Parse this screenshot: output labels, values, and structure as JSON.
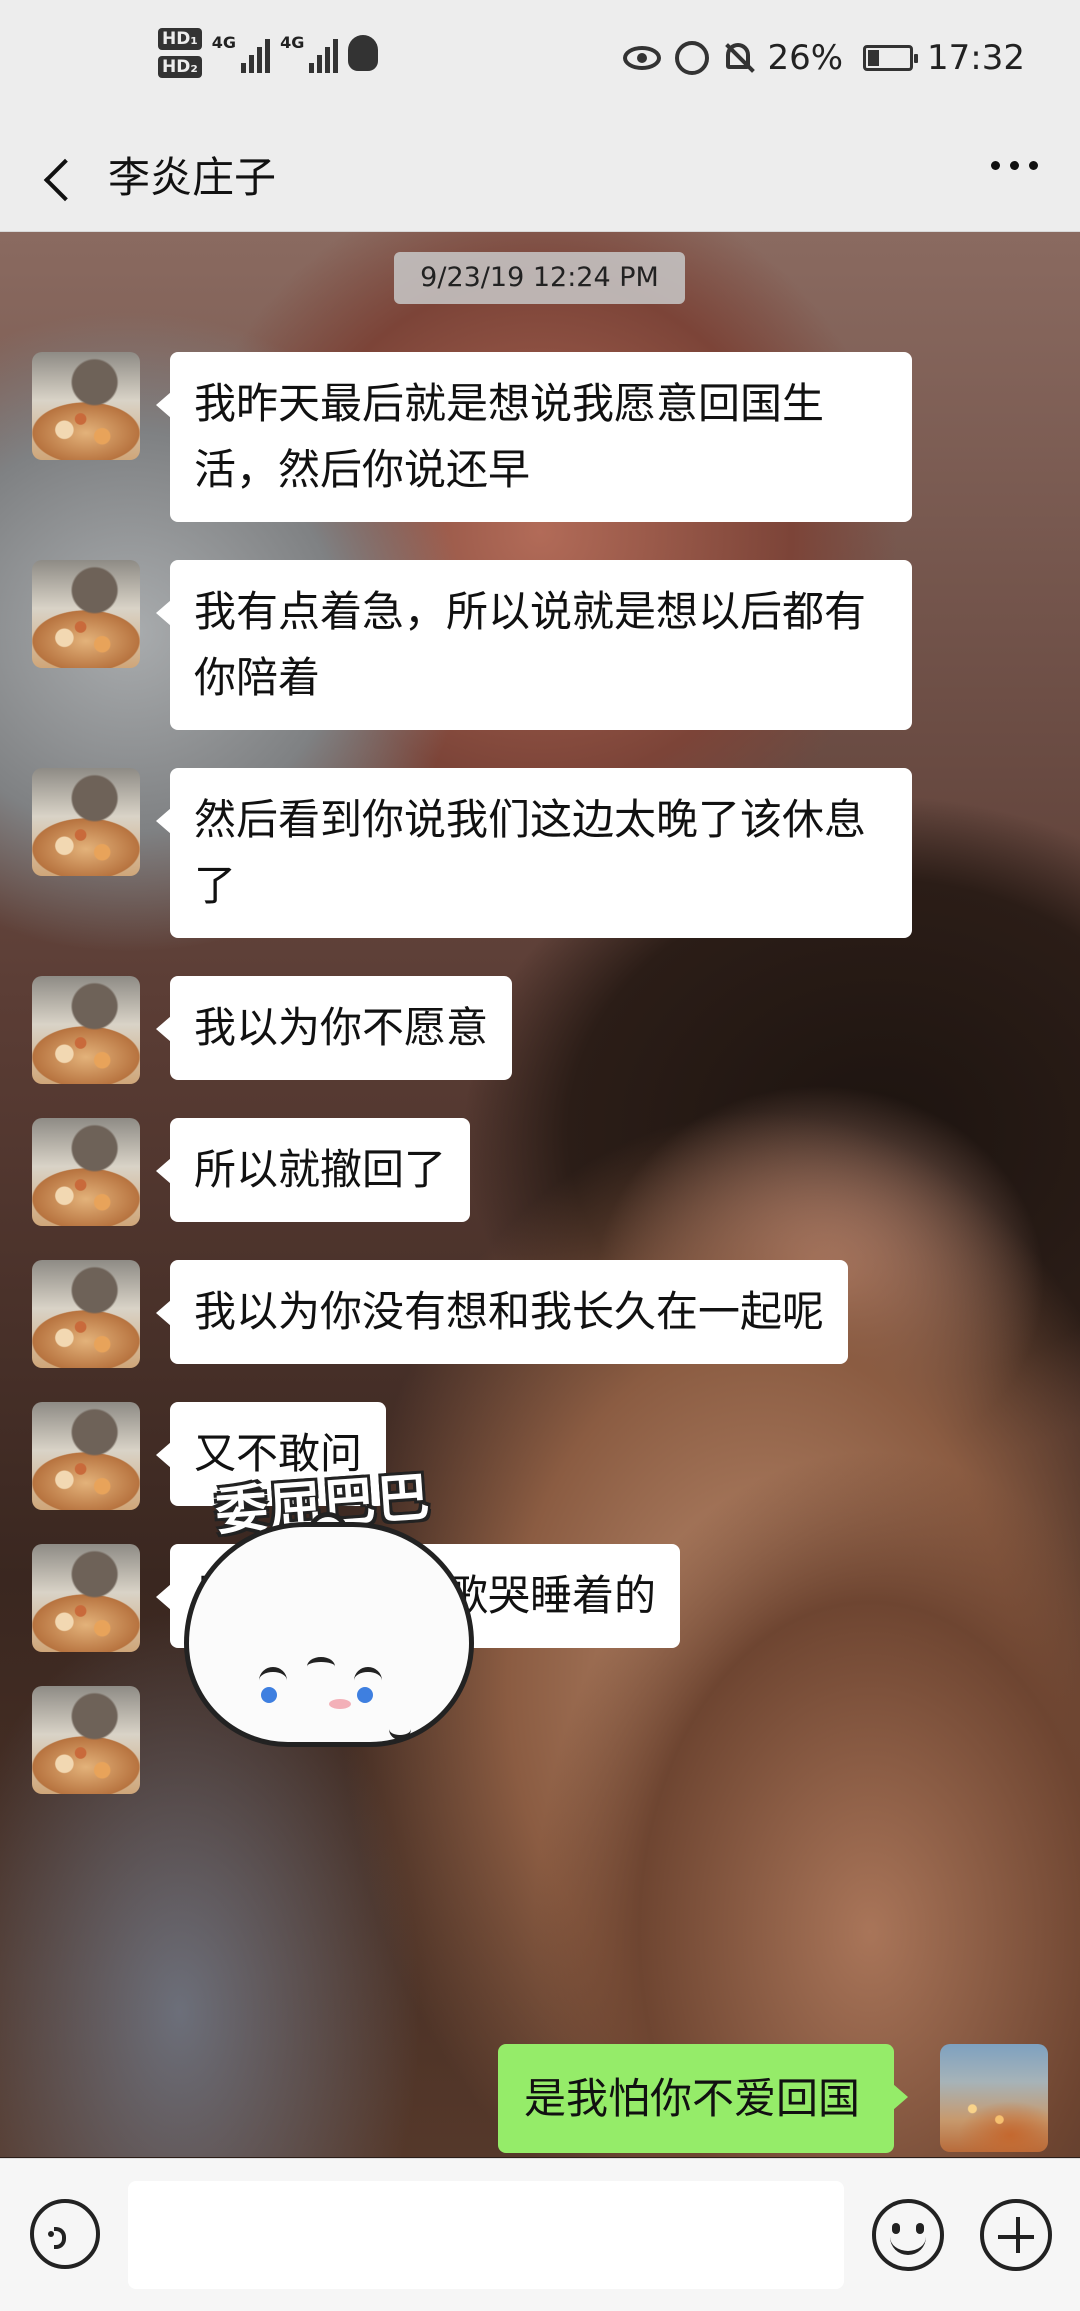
{
  "status_bar": {
    "hd1": "HD₁",
    "hd2": "HD₂",
    "net1": "4G",
    "net2": "4G",
    "battery_percent": "26%",
    "battery_level": 0.26,
    "time": "17:32"
  },
  "header": {
    "title": "李炎庄子"
  },
  "chat": {
    "timestamp": "9/23/19 12:24 PM",
    "incoming": [
      {
        "text": "我昨天最后就是想说我愿意回国生活，然后你说还早"
      },
      {
        "text": "我有点着急，所以说就是想以后都有你陪着"
      },
      {
        "text": "然后看到你说我们这边太晚了该休息了"
      },
      {
        "text": "我以为你不愿意"
      },
      {
        "text": "所以就撤回了"
      },
      {
        "text": "我以为你没有想和我长久在一起呢"
      },
      {
        "text": "又不敢问"
      },
      {
        "text": "最后自己听着歌哭睡着的"
      }
    ],
    "sticker_text": "委屈巴巴",
    "outgoing": [
      {
        "text": "是我怕你不爱回国"
      }
    ]
  },
  "input_bar": {
    "placeholder": ""
  }
}
